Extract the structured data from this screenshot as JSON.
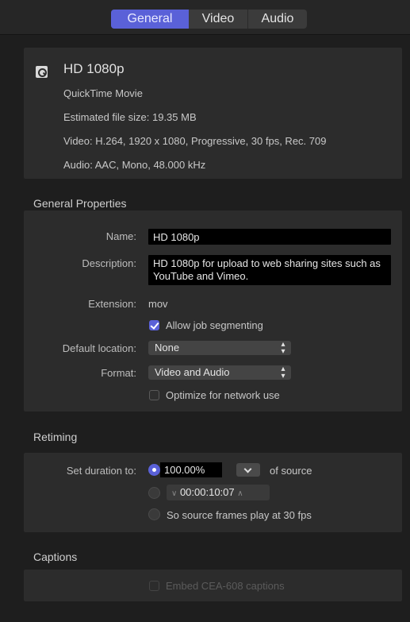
{
  "tabs": [
    {
      "label": "General",
      "active": true
    },
    {
      "label": "Video",
      "active": false
    },
    {
      "label": "Audio",
      "active": false
    }
  ],
  "summary": {
    "icon": "quicktime-icon",
    "title": "HD 1080p",
    "lines": [
      "QuickTime Movie",
      "Estimated file size: 19.35 MB",
      "Video: H.264, 1920 x 1080, Progressive, 30 fps, Rec. 709",
      "Audio: AAC, Mono, 48.000 kHz"
    ]
  },
  "general_properties": {
    "title": "General Properties",
    "name_label": "Name:",
    "name_value": "HD 1080p",
    "description_label": "Description:",
    "description_value": "HD 1080p for upload to web sharing sites such as YouTube and Vimeo.",
    "extension_label": "Extension:",
    "extension_value": "mov",
    "allow_segmenting_label": "Allow job segmenting",
    "allow_segmenting_checked": true,
    "default_location_label": "Default location:",
    "default_location_value": "None",
    "format_label": "Format:",
    "format_value": "Video and Audio",
    "optimize_label": "Optimize for network use",
    "optimize_checked": false
  },
  "retiming": {
    "title": "Retiming",
    "set_duration_label": "Set duration to:",
    "percent_value": "100.00%",
    "of_source_label": "of source",
    "timecode_value": "00:00:10:07",
    "frames_label": "So source frames play at 30 fps",
    "selected_option": "percent"
  },
  "captions": {
    "title": "Captions",
    "embed_label": "Embed CEA-608 captions",
    "embed_checked": false,
    "embed_enabled": false
  },
  "colors": {
    "accent": "#5a61d8",
    "background": "#1e1e1e",
    "panel": "#2c2c2c"
  }
}
